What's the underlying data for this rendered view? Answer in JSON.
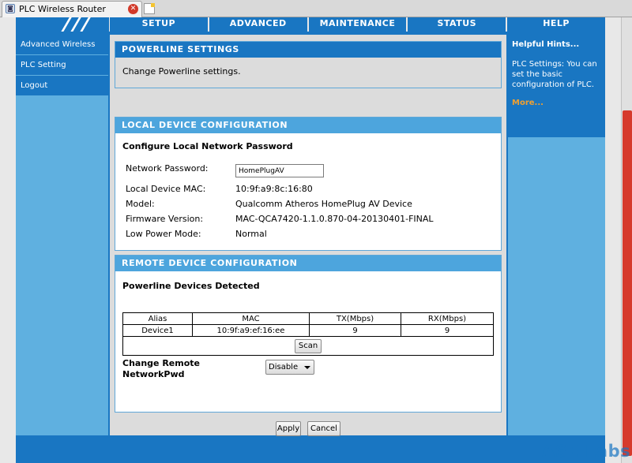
{
  "browser": {
    "tab_title": "PLC Wireless Router"
  },
  "topnav": [
    {
      "label": "SETUP"
    },
    {
      "label": "ADVANCED"
    },
    {
      "label": "MAINTENANCE"
    },
    {
      "label": "STATUS"
    },
    {
      "label": "HELP"
    }
  ],
  "sidebar": {
    "items": [
      {
        "label": "Advanced Wireless"
      },
      {
        "label": "PLC Setting"
      },
      {
        "label": "Logout"
      }
    ]
  },
  "powerline": {
    "heading": "POWERLINE SETTINGS",
    "description": "Change Powerline settings."
  },
  "local": {
    "heading": "LOCAL DEVICE CONFIGURATION",
    "subheading": "Configure Local Network Password",
    "password_label": "Network Password:",
    "password_value": "HomePlugAV",
    "mac_label": "Local Device MAC:",
    "mac_value": "10:9f:a9:8c:16:80",
    "model_label": "Model:",
    "model_value": "Qualcomm Atheros HomePlug AV Device",
    "firmware_label": "Firmware Version:",
    "firmware_value": "MAC-QCA7420-1.1.0.870-04-20130401-FINAL",
    "lowpower_label": "Low Power Mode:",
    "lowpower_value": "Normal"
  },
  "remote": {
    "heading": "REMOTE DEVICE CONFIGURATION",
    "subheading": "Powerline Devices Detected",
    "columns": [
      "Alias",
      "MAC",
      "TX(Mbps)",
      "RX(Mbps)"
    ],
    "rows": [
      [
        "Device1",
        "10:9f:a9:ef:16:ee",
        "9",
        "9"
      ]
    ],
    "scan_label": "Scan",
    "change_label": "Change Remote NetworkPwd",
    "change_value": "Disable"
  },
  "actions": {
    "apply_label": "Apply",
    "cancel_label": "Cancel"
  },
  "hints": {
    "title": "Helpful Hints...",
    "body": "PLC Settings: You can set the basic configuration of PLC.",
    "more": "More..."
  },
  "watermark": "ASE Labs"
}
